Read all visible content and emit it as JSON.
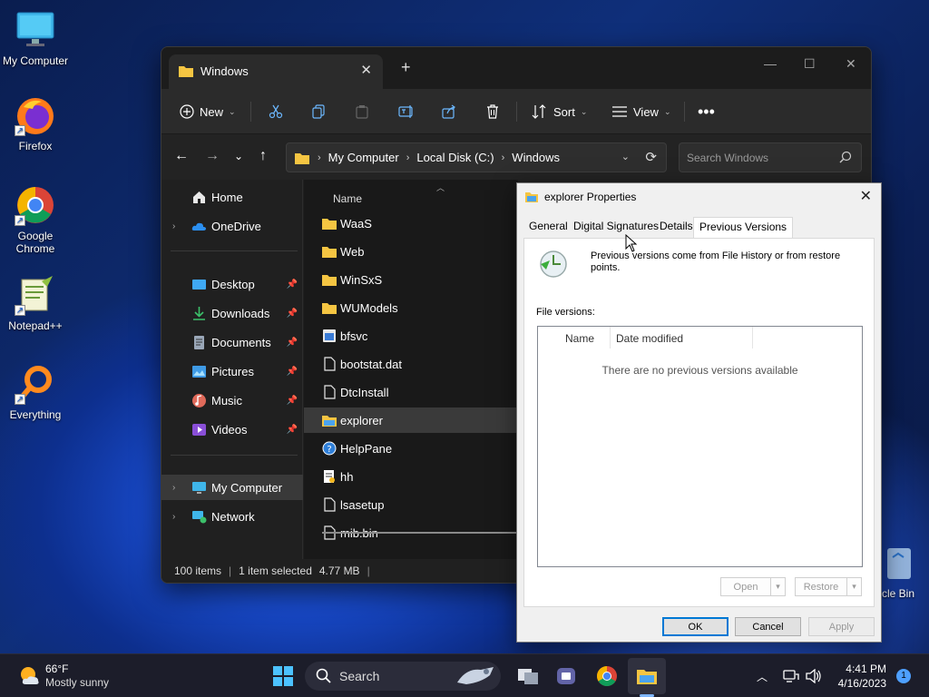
{
  "desktop": {
    "icons": [
      {
        "label": "My Computer"
      },
      {
        "label": "Firefox"
      },
      {
        "label": "Google Chrome"
      },
      {
        "label": "Notepad++"
      },
      {
        "label": "Everything"
      }
    ],
    "recycle_bin_partial": "cle Bin"
  },
  "explorer": {
    "tab_title": "Windows",
    "toolbar": {
      "new": "New",
      "sort": "Sort",
      "view": "View"
    },
    "breadcrumb": [
      "My Computer",
      "Local Disk (C:)",
      "Windows"
    ],
    "search_placeholder": "Search Windows",
    "sidebar": {
      "home": "Home",
      "onedrive": "OneDrive",
      "desktop": "Desktop",
      "downloads": "Downloads",
      "documents": "Documents",
      "pictures": "Pictures",
      "music": "Music",
      "videos": "Videos",
      "my_computer": "My Computer",
      "network": "Network"
    },
    "column_name": "Name",
    "files": [
      {
        "name": "WaaS"
      },
      {
        "name": "Web"
      },
      {
        "name": "WinSxS"
      },
      {
        "name": "WUModels"
      },
      {
        "name": "bfsvc"
      },
      {
        "name": "bootstat.dat"
      },
      {
        "name": "DtcInstall"
      },
      {
        "name": "explorer"
      },
      {
        "name": "HelpPane"
      },
      {
        "name": "hh"
      },
      {
        "name": "lsasetup"
      },
      {
        "name": "mib.bin"
      }
    ],
    "status": {
      "items": "100 items",
      "selected": "1 item selected",
      "size": "4.77 MB"
    }
  },
  "dialog": {
    "title": "explorer Properties",
    "tabs": {
      "general": "General",
      "digital_signatures": "Digital Signatures",
      "details": "Details",
      "previous_versions": "Previous Versions"
    },
    "info": "Previous versions come from File History or from restore points.",
    "file_versions_label": "File versions:",
    "col_name": "Name",
    "col_date": "Date modified",
    "empty": "There are no previous versions available",
    "open": "Open",
    "restore": "Restore",
    "ok": "OK",
    "cancel": "Cancel",
    "apply": "Apply"
  },
  "taskbar": {
    "temp": "66°F",
    "weather": "Mostly sunny",
    "search": "Search",
    "time": "4:41 PM",
    "date": "4/16/2023",
    "notifications": "1"
  }
}
